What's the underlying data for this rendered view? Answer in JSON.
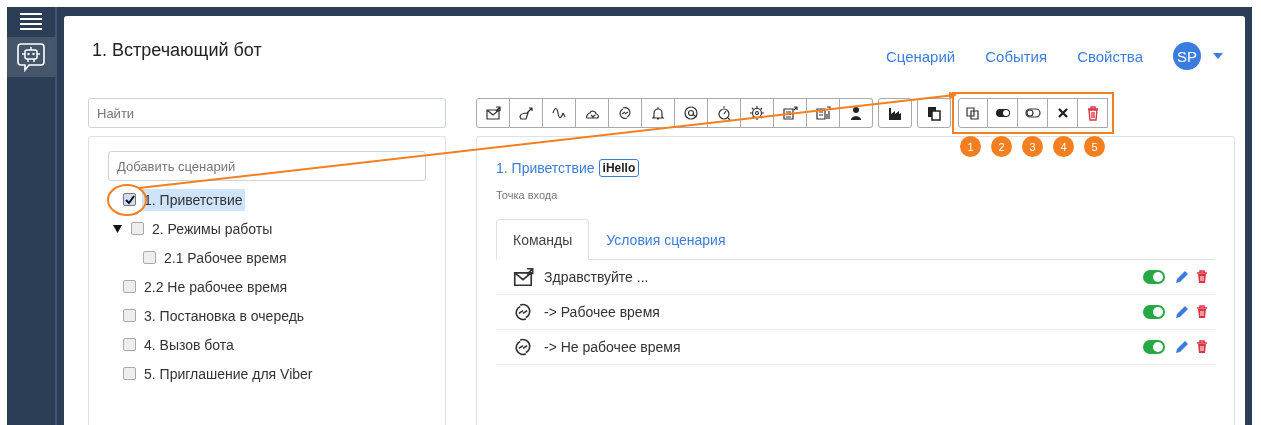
{
  "header": {
    "title": "1. Встречающий бот",
    "nav": [
      {
        "label": "Сценарий"
      },
      {
        "label": "События"
      },
      {
        "label": "Свойства"
      }
    ],
    "avatar": "SP"
  },
  "search": {
    "placeholder": "Найти"
  },
  "add_scenario": {
    "placeholder": "Добавить сценарий"
  },
  "tree": [
    {
      "label": "1. Приветствие",
      "checked": true,
      "selected": true
    },
    {
      "label": "2. Режимы работы",
      "checked": false,
      "selected": false,
      "expanded": true,
      "children": [
        {
          "label": "2.1 Рабочее время",
          "checked": false,
          "selected": false
        }
      ]
    },
    {
      "label": "2.2 Не рабочее время",
      "checked": false,
      "selected": false
    },
    {
      "label": "3. Постановка в очередь",
      "checked": false,
      "selected": false
    },
    {
      "label": "4. Вызов бота",
      "checked": false,
      "selected": false
    },
    {
      "label": "5. Приглашение для Viber",
      "checked": false,
      "selected": false
    }
  ],
  "callouts": [
    "1",
    "2",
    "3",
    "4",
    "5"
  ],
  "scenario": {
    "title": "1. Приветствие",
    "tag": "iHello",
    "subtitle": "Точка входа"
  },
  "tabs": [
    {
      "label": "Команды",
      "selected": true
    },
    {
      "label": "Условия сценария",
      "selected": false
    }
  ],
  "commands": [
    {
      "kind": "message",
      "text": "Здравствуйте ...",
      "on": true
    },
    {
      "kind": "transition",
      "text": "-> Рабочее время",
      "on": true
    },
    {
      "kind": "transition",
      "text": "-> Не рабочее время",
      "on": true
    }
  ]
}
